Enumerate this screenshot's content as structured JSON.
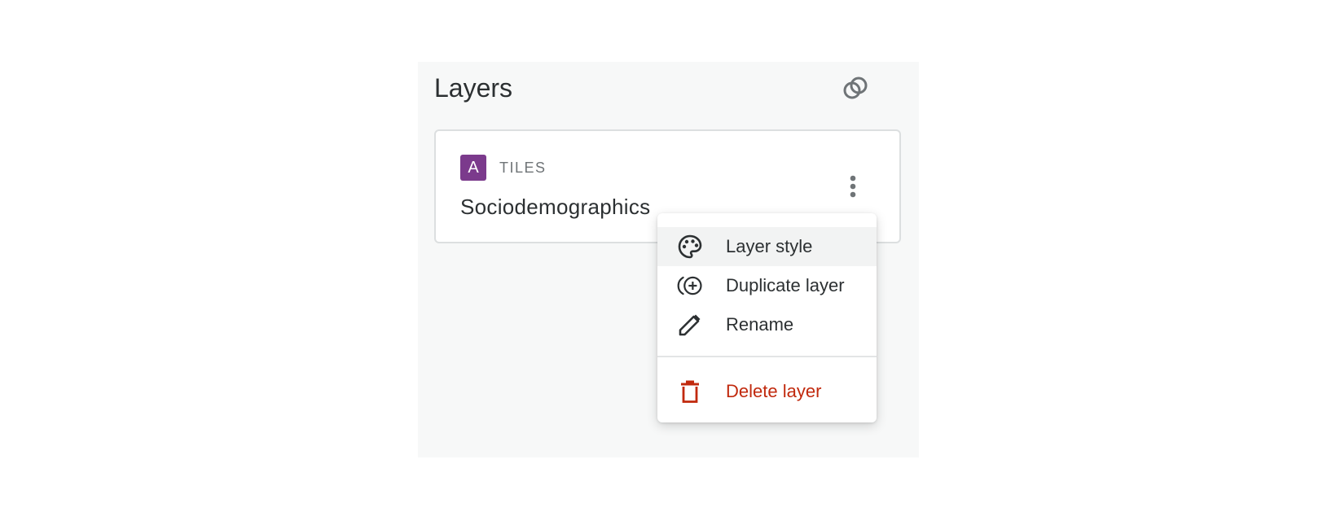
{
  "panel": {
    "title": "Layers",
    "link_icon": "overlapping-rings-icon"
  },
  "layer_card": {
    "badge_letter": "A",
    "badge_color": "#7b3a8c",
    "type": "TILES",
    "name": "Sociodemographics",
    "more_icon": "more-vert-icon"
  },
  "menu": {
    "items": [
      {
        "label": "Layer style",
        "icon": "palette-icon",
        "highlighted": true
      },
      {
        "label": "Duplicate layer",
        "icon": "duplicate-plus-icon"
      },
      {
        "label": "Rename",
        "icon": "pencil-icon"
      },
      {
        "label": "Delete layer",
        "icon": "trash-icon",
        "color": "#c1290d"
      }
    ]
  }
}
